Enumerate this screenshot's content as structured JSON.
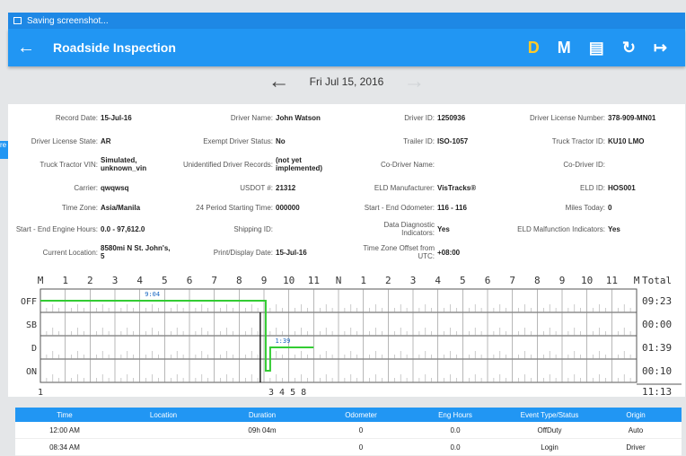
{
  "status_bar": {
    "text": "Saving screenshot..."
  },
  "app_bar": {
    "title": "Roadside Inspection",
    "actions": [
      "D",
      "M"
    ]
  },
  "date_bar": {
    "date": "Fri Jul 15, 2016"
  },
  "left_tab": {
    "text": "re"
  },
  "info": [
    [
      {
        "label": "Record Date:",
        "value": "15-Jul-16"
      },
      {
        "label": "Driver Name:",
        "value": "John Watson"
      },
      {
        "label": "Driver ID:",
        "value": "1250936"
      },
      {
        "label": "Driver License Number:",
        "value": "378-909-MN01"
      }
    ],
    [
      {
        "label": "Driver License State:",
        "value": "AR"
      },
      {
        "label": "Exempt Driver Status:",
        "value": "No"
      },
      {
        "label": "Trailer ID:",
        "value": "ISO-1057"
      },
      {
        "label": "Truck Tractor ID:",
        "value": "KU10 LMO"
      }
    ],
    [
      {
        "label": "Truck Tractor VIN:",
        "value": "Simulated, unknown_vin"
      },
      {
        "label": "Unidentified Driver Records:",
        "value": "(not yet implemented)"
      },
      {
        "label": "Co-Driver Name:",
        "value": ""
      },
      {
        "label": "Co-Driver ID:",
        "value": ""
      }
    ],
    [
      {
        "label": "Carrier:",
        "value": "qwqwsq"
      },
      {
        "label": "USDOT #:",
        "value": "21312"
      },
      {
        "label": "ELD Manufacturer:",
        "value": "VisTracks®"
      },
      {
        "label": "ELD ID:",
        "value": "HOS001"
      }
    ],
    [
      {
        "label": "Time Zone:",
        "value": "Asia/Manila"
      },
      {
        "label": "24 Period Starting Time:",
        "value": "000000"
      },
      {
        "label": "Start - End Odometer:",
        "value": "116 - 116"
      },
      {
        "label": "Miles Today:",
        "value": "0"
      }
    ],
    [
      {
        "label": "Start - End Engine Hours:",
        "value": "0.0 - 97,612.0"
      },
      {
        "label": "Shipping ID:",
        "value": ""
      },
      {
        "label": "Data Diagnostic Indicators:",
        "value": "Yes"
      },
      {
        "label": "ELD Malfunction Indicators:",
        "value": "Yes"
      }
    ],
    [
      {
        "label": "Current Location:",
        "value": "8580mi N St. John's, 5"
      },
      {
        "label": "Print/Display Date:",
        "value": "15-Jul-16"
      },
      {
        "label": "Time Zone Offset from UTC:",
        "value": "+08:00"
      },
      {
        "label": "",
        "value": ""
      }
    ]
  ],
  "graph": {
    "hour_labels": [
      "M",
      "1",
      "2",
      "3",
      "4",
      "5",
      "6",
      "7",
      "8",
      "9",
      "10",
      "11",
      "N",
      "1",
      "2",
      "3",
      "4",
      "5",
      "6",
      "7",
      "8",
      "9",
      "10",
      "11",
      "M"
    ],
    "rows": [
      "OFF",
      "SB",
      "D",
      "ON"
    ],
    "total_header": "Total",
    "totals": [
      "09:23",
      "00:00",
      "01:39",
      "00:10"
    ],
    "grand_total": "11:13",
    "bottom_left": "1",
    "bottom_mid": "3 4 5 8",
    "segment_labels": [
      "9:04",
      "1:39"
    ],
    "line_color": "#33cc33"
  },
  "table": {
    "columns": [
      "Time",
      "Location",
      "Duration",
      "Odometer",
      "Eng Hours",
      "Event Type/Status",
      "Origin"
    ],
    "rows": [
      [
        "12:00 AM",
        "",
        "09h 04m",
        "0",
        "0.0",
        "OffDuty",
        "Auto"
      ],
      [
        "08:34 AM",
        "",
        "",
        "0",
        "0.0",
        "Login",
        "Driver"
      ]
    ]
  }
}
